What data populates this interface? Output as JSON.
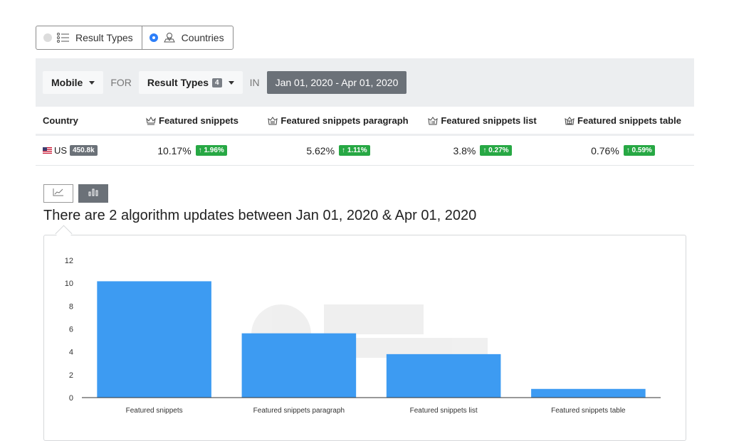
{
  "toggle": {
    "options": [
      {
        "label": "Result Types",
        "selected": false,
        "icon": "list-icon"
      },
      {
        "label": "Countries",
        "selected": true,
        "icon": "map-pin-icon"
      }
    ]
  },
  "filter": {
    "device": "Mobile",
    "for_label": "FOR",
    "result_types": "Result Types",
    "result_types_count": "4",
    "in_label": "IN",
    "date_range": "Jan 01, 2020 - Apr 01, 2020"
  },
  "table": {
    "headers": [
      "Country",
      "Featured snippets",
      "Featured snippets paragraph",
      "Featured snippets list",
      "Featured snippets table"
    ],
    "row": {
      "country": "US",
      "volume": "450.8k",
      "cells": [
        {
          "value": "10.17%",
          "change": "↑ 1.96%"
        },
        {
          "value": "5.62%",
          "change": "↑ 1.11%"
        },
        {
          "value": "3.8%",
          "change": "↑ 0.27%"
        },
        {
          "value": "0.76%",
          "change": "↑ 0.59%"
        }
      ]
    }
  },
  "headline": "There are 2 algorithm updates between Jan 01, 2020 & Apr 01, 2020",
  "colors": {
    "bar": "#3d9bf2",
    "badge_green": "#27a844",
    "filterbar": "#eceef0"
  },
  "chart_data": {
    "type": "bar",
    "categories": [
      "Featured snippets",
      "Featured snippets paragraph",
      "Featured snippets list",
      "Featured snippets table"
    ],
    "values": [
      10.17,
      5.62,
      3.8,
      0.76
    ],
    "yticks": [
      0,
      2,
      4,
      6,
      8,
      10,
      12
    ],
    "ylim": [
      0,
      12
    ],
    "grid": false,
    "legend": "none"
  }
}
